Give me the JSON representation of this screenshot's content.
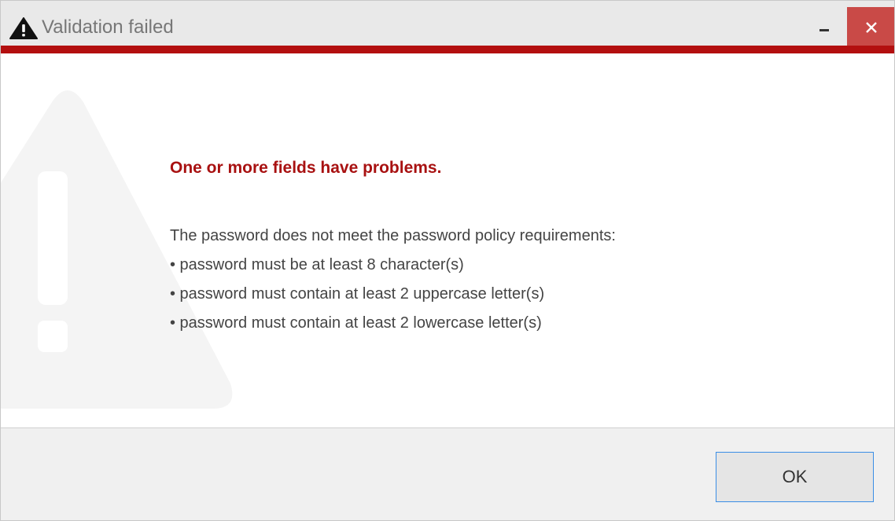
{
  "window": {
    "title": "Validation failed",
    "title_icon": "warning-icon",
    "controls": {
      "minimize_icon": "minimize-icon",
      "close_icon": "close-icon"
    },
    "accent_color": "#b30f0f"
  },
  "content": {
    "watermark_icon": "warning-icon",
    "heading": "One or more fields have problems.",
    "heading_color": "#a81111",
    "message_lines": [
      "The password does not meet the password policy requirements:",
      "• password must be at least 8 character(s)",
      "• password must contain at least 2 uppercase letter(s)",
      "• password must contain at least 2 lowercase letter(s)"
    ]
  },
  "footer": {
    "ok_label": "OK"
  }
}
